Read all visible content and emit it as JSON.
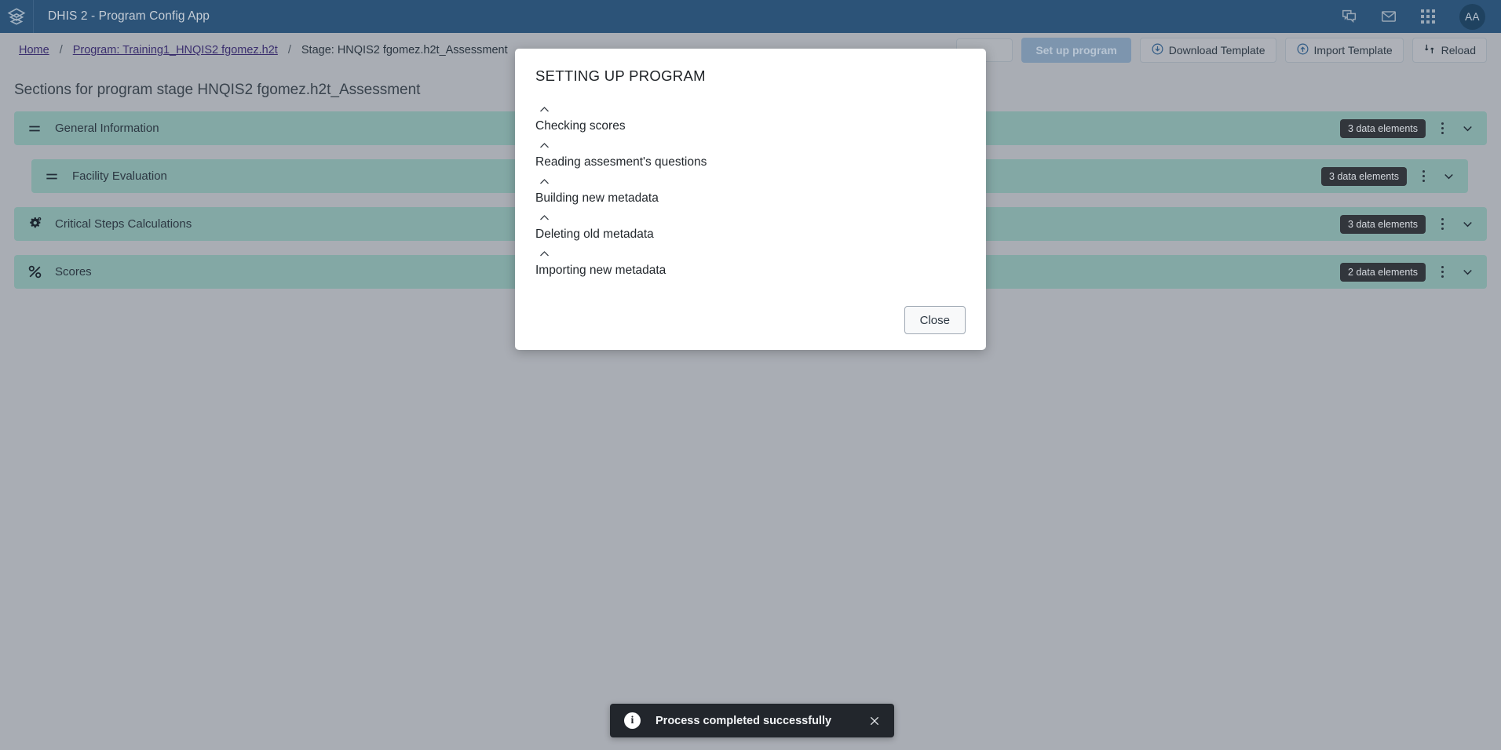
{
  "header": {
    "logo_icon": "dhis2-layers-logo",
    "app_title": "DHIS 2 - Program Config App",
    "icons": [
      {
        "name": "messages-icon",
        "glyph": "chat"
      },
      {
        "name": "mail-icon",
        "glyph": "envelope"
      },
      {
        "name": "apps-grid-icon",
        "glyph": "grid"
      }
    ],
    "avatar_initials": "AA",
    "bg_color": "#2c5378"
  },
  "toolbar": {
    "breadcrumbs": [
      {
        "label": "Home",
        "link": true
      },
      {
        "label": "Program: Training1_HNQIS2 fgomez.h2t",
        "link": true
      },
      {
        "label": "Stage: HNQIS2 fgomez.h2t_Assessment",
        "link": false
      }
    ],
    "separator": "/",
    "setup_program_label": "Set up program",
    "download_template_label": "Download Template",
    "import_template_label": "Import Template",
    "reload_label": "Reload"
  },
  "main": {
    "page_title": "Sections for program stage HNQIS2 fgomez.h2t_Assessment",
    "sections": [
      {
        "label": "General Information",
        "icon": "drag-handle-icon",
        "badge": "3 data elements",
        "indent": false
      },
      {
        "label": "Facility Evaluation",
        "icon": "drag-handle-icon",
        "badge": "3 data elements",
        "indent": true
      },
      {
        "label": "Critical Steps Calculations",
        "icon": "gear-icon",
        "badge": "3 data elements",
        "indent": false
      },
      {
        "label": "Scores",
        "icon": "percent-icon",
        "badge": "2 data elements",
        "indent": false
      }
    ],
    "row_color": "#83a8a5",
    "badge_color": "#32363c"
  },
  "modal": {
    "title": "SETTING UP PROGRAM",
    "steps": [
      {
        "label": "Checking scores",
        "icon": "chevron-up-icon"
      },
      {
        "label": "Reading assesment's questions",
        "icon": "chevron-up-icon"
      },
      {
        "label": "Building new metadata",
        "icon": "chevron-up-icon"
      },
      {
        "label": "Deleting old metadata",
        "icon": "chevron-up-icon"
      },
      {
        "label": "Importing new metadata",
        "icon": "chevron-up-icon"
      }
    ],
    "close_label": "Close"
  },
  "toast": {
    "icon": "info-icon",
    "icon_glyph": "i",
    "message": "Process completed successfully",
    "close_icon": "close-icon",
    "bg_color": "#22262c"
  }
}
